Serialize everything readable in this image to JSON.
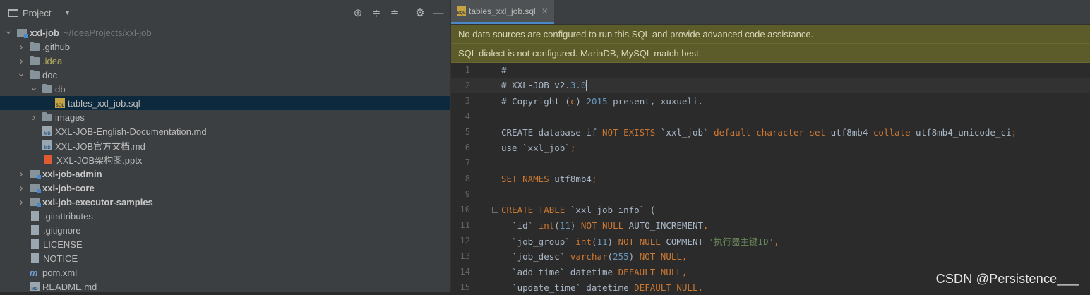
{
  "project_panel": {
    "title": "Project",
    "tree": [
      {
        "level": 0,
        "chev": "open",
        "icon": "module",
        "label": "xxl-job",
        "bold": true,
        "path": "~/IdeaProjects/xxl-job"
      },
      {
        "level": 1,
        "chev": "closed",
        "icon": "folder",
        "label": ".github"
      },
      {
        "level": 1,
        "chev": "closed",
        "icon": "folder",
        "label": ".idea",
        "idea": true
      },
      {
        "level": 1,
        "chev": "open",
        "icon": "folder",
        "label": "doc"
      },
      {
        "level": 2,
        "chev": "open",
        "icon": "folder",
        "label": "db"
      },
      {
        "level": 3,
        "chev": "none",
        "icon": "sql",
        "label": "tables_xxl_job.sql",
        "selected": true
      },
      {
        "level": 2,
        "chev": "closed",
        "icon": "folder",
        "label": "images"
      },
      {
        "level": 2,
        "chev": "none",
        "icon": "md",
        "label": "XXL-JOB-English-Documentation.md"
      },
      {
        "level": 2,
        "chev": "none",
        "icon": "md",
        "label": "XXL-JOB官方文档.md"
      },
      {
        "level": 2,
        "chev": "none",
        "icon": "pptx",
        "label": "XXL-JOB架构图.pptx"
      },
      {
        "level": 1,
        "chev": "closed",
        "icon": "module",
        "label": "xxl-job-admin",
        "bold": true
      },
      {
        "level": 1,
        "chev": "closed",
        "icon": "module",
        "label": "xxl-job-core",
        "bold": true
      },
      {
        "level": 1,
        "chev": "closed",
        "icon": "module",
        "label": "xxl-job-executor-samples",
        "bold": true
      },
      {
        "level": 1,
        "chev": "none",
        "icon": "file",
        "label": ".gitattributes"
      },
      {
        "level": 1,
        "chev": "none",
        "icon": "file",
        "label": ".gitignore"
      },
      {
        "level": 1,
        "chev": "none",
        "icon": "file",
        "label": "LICENSE"
      },
      {
        "level": 1,
        "chev": "none",
        "icon": "file",
        "label": "NOTICE"
      },
      {
        "level": 1,
        "chev": "none",
        "icon": "maven",
        "label": "pom.xml"
      },
      {
        "level": 1,
        "chev": "none",
        "icon": "md",
        "label": "README.md"
      }
    ]
  },
  "editor": {
    "tab_label": "tables_xxl_job.sql",
    "banners": [
      "No data sources are configured to run this SQL and provide advanced code assistance.",
      "SQL dialect is not configured. MariaDB, MySQL match best."
    ],
    "lines": [
      [
        {
          "t": "#"
        }
      ],
      [
        {
          "t": "# XXL-JOB v2."
        },
        {
          "t": "3.0",
          "c": "num"
        }
      ],
      [
        {
          "t": "# Copyright ("
        },
        {
          "t": "c",
          "c": "kw"
        },
        {
          "t": ") "
        },
        {
          "t": "2015",
          "c": "num"
        },
        {
          "t": "-present, xuxueli."
        }
      ],
      [],
      [
        {
          "t": "CREATE database if "
        },
        {
          "t": "NOT EXISTS",
          "c": "kw"
        },
        {
          "t": " `xxl_job` "
        },
        {
          "t": "default character set",
          "c": "kw"
        },
        {
          "t": " utf8mb4 "
        },
        {
          "t": "collate",
          "c": "kw"
        },
        {
          "t": " utf8mb4_unicode_ci"
        },
        {
          "t": ";",
          "c": "kw"
        }
      ],
      [
        {
          "t": "use `xxl_job`"
        },
        {
          "t": ";",
          "c": "kw"
        }
      ],
      [],
      [
        {
          "t": "SET NAMES",
          "c": "kw"
        },
        {
          "t": " utf8mb4"
        },
        {
          "t": ";",
          "c": "kw"
        }
      ],
      [],
      [
        {
          "t": "CREATE TABLE",
          "c": "kw"
        },
        {
          "t": " `xxl_job_info` ("
        }
      ],
      [
        {
          "t": "  `id` "
        },
        {
          "t": "int",
          "c": "kw"
        },
        {
          "t": "("
        },
        {
          "t": "11",
          "c": "num"
        },
        {
          "t": ") "
        },
        {
          "t": "NOT NULL",
          "c": "kw"
        },
        {
          "t": " AUTO_INCREMENT"
        },
        {
          "t": ",",
          "c": "kw"
        }
      ],
      [
        {
          "t": "  `job_group` "
        },
        {
          "t": "int",
          "c": "kw"
        },
        {
          "t": "("
        },
        {
          "t": "11",
          "c": "num"
        },
        {
          "t": ") "
        },
        {
          "t": "NOT NULL",
          "c": "kw"
        },
        {
          "t": " COMMENT "
        },
        {
          "t": "'执行器主键ID'",
          "c": "str"
        },
        {
          "t": ",",
          "c": "kw"
        }
      ],
      [
        {
          "t": "  `job_desc` "
        },
        {
          "t": "varchar",
          "c": "kw"
        },
        {
          "t": "("
        },
        {
          "t": "255",
          "c": "num"
        },
        {
          "t": ") "
        },
        {
          "t": "NOT NULL",
          "c": "kw"
        },
        {
          "t": ",",
          "c": "kw"
        }
      ],
      [
        {
          "t": "  `add_time` datetime "
        },
        {
          "t": "DEFAULT NULL",
          "c": "kw"
        },
        {
          "t": ",",
          "c": "kw"
        }
      ],
      [
        {
          "t": "  `update_time` datetime "
        },
        {
          "t": "DEFAULT NULL",
          "c": "kw"
        },
        {
          "t": ",",
          "c": "kw"
        }
      ]
    ],
    "current_line": 2
  },
  "watermark": "CSDN @Persistence___"
}
